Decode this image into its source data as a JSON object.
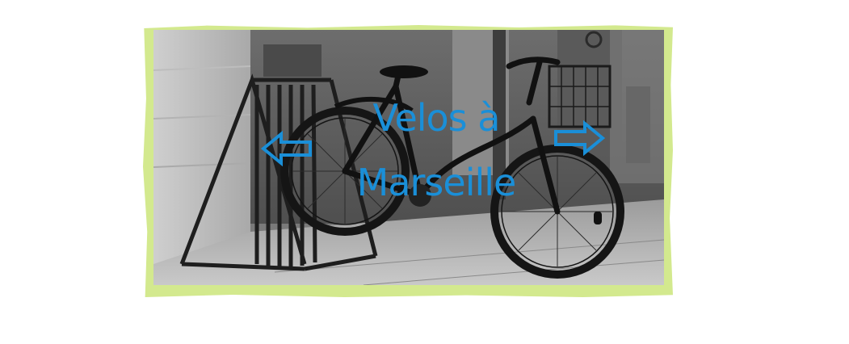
{
  "banner": {
    "title_line1": "Velos à",
    "title_line2": "Marseille",
    "accent_color": "#1a8fd8",
    "frame_color": "#d3e98e",
    "photo_style": "black-and-white"
  },
  "navigation": {
    "prev_icon": "arrow-left-outline-icon",
    "next_icon": "arrow-right-outline-icon"
  }
}
